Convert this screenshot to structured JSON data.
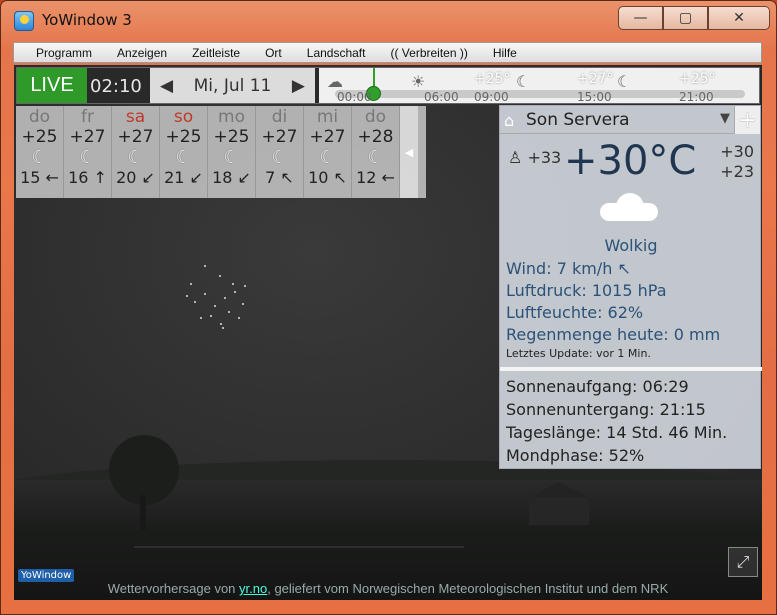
{
  "window": {
    "title": "YoWindow 3",
    "min": "—",
    "max": "▢",
    "close": "✕"
  },
  "menu": [
    "Programm",
    "Anzeigen",
    "Zeitleiste",
    "Ort",
    "Landschaft",
    "(( Verbreiten ))",
    "Hilfe"
  ],
  "topbar": {
    "live": "LIVE",
    "time": "02:10",
    "date": "Mi, Jul 11",
    "prev": "◀",
    "next": "▶",
    "timeline": {
      "times": [
        "00:00",
        "06:00",
        "09:00",
        "15:00",
        "21:00"
      ],
      "temps": [
        "+25°",
        "+27°",
        "+25°"
      ]
    }
  },
  "forecast": [
    {
      "day": "do",
      "temp": "+25",
      "wind": "15 ←",
      "weekend": false
    },
    {
      "day": "fr",
      "temp": "+27",
      "wind": "16 ↑",
      "weekend": false
    },
    {
      "day": "sa",
      "temp": "+27",
      "wind": "20 ↙",
      "weekend": true
    },
    {
      "day": "so",
      "temp": "+25",
      "wind": "21 ↙",
      "weekend": true
    },
    {
      "day": "mo",
      "temp": "+25",
      "wind": "18 ↙",
      "weekend": false
    },
    {
      "day": "di",
      "temp": "+27",
      "wind": "7 ↖",
      "weekend": false
    },
    {
      "day": "mi",
      "temp": "+27",
      "wind": "10 ↖",
      "weekend": false
    },
    {
      "day": "do",
      "temp": "+28",
      "wind": "12 ←",
      "weekend": false
    }
  ],
  "panel": {
    "location": "Son Servera",
    "feels": "+33",
    "temp": "+30°C",
    "high": "+30",
    "low": "+23",
    "condition": "Wolkig",
    "wind": "Wind:  7 km/h",
    "wind_arrow": "↖",
    "pressure": "Luftdruck:  1015 hPa",
    "humidity": "Luftfeuchte:  62%",
    "rain": "Regenmenge heute:  0 mm",
    "updated": "Letztes Update:  vor 1 Min.",
    "sunrise": "Sonnenaufgang:  06:29",
    "sunset": "Sonnenuntergang:  21:15",
    "daylength": "Tageslänge:  14 Std. 46 Min.",
    "moon": "Mondphase:  52%"
  },
  "footer": {
    "prefix": "Wettervorhersage von ",
    "link": "yr.no",
    "suffix": ", geliefert vom Norwegischen Meteorologischen Institut und dem NRK"
  },
  "logo": "YoWindow"
}
